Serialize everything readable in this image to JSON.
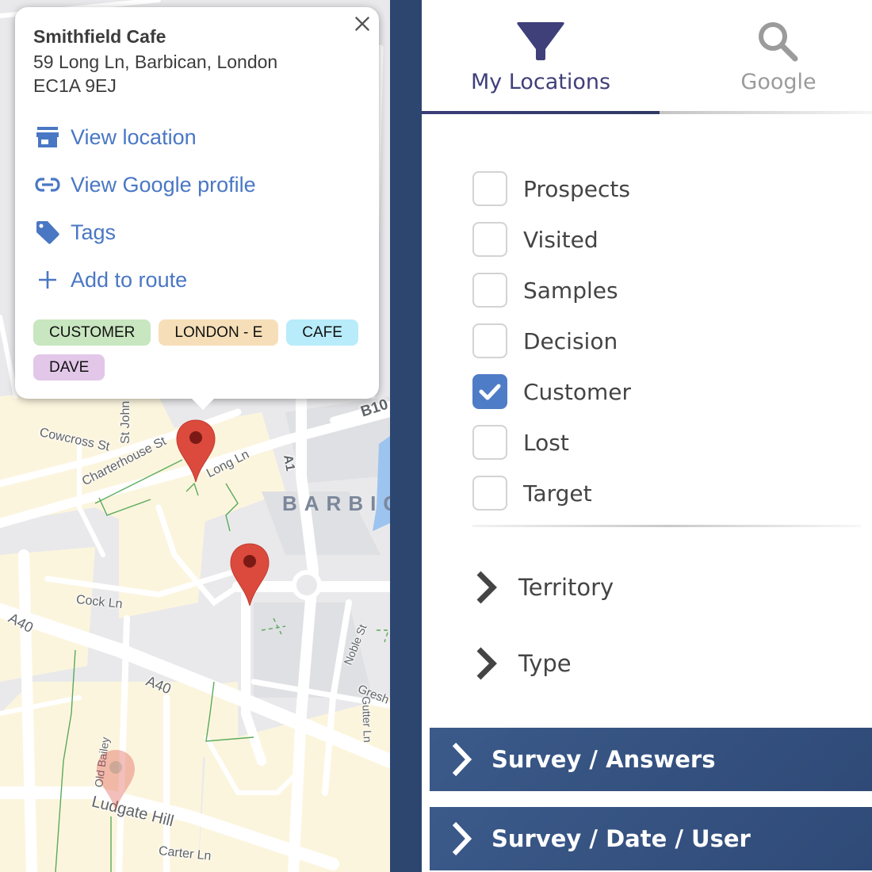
{
  "map": {
    "street_labels": [
      {
        "text": "Cowcross St",
        "name": "street-cowcross"
      },
      {
        "text": "St John",
        "name": "street-st-john"
      },
      {
        "text": "Charterhouse St",
        "name": "street-charterhouse"
      },
      {
        "text": "Long Ln",
        "name": "street-long-ln"
      },
      {
        "text": "A1",
        "name": "road-a1"
      },
      {
        "text": "B10",
        "name": "road-b10"
      },
      {
        "text": "Cock Ln",
        "name": "street-cock-ln"
      },
      {
        "text": "A40",
        "name": "road-a40-west"
      },
      {
        "text": "A40",
        "name": "road-a40"
      },
      {
        "text": "Noble St",
        "name": "street-noble"
      },
      {
        "text": "Gresh",
        "name": "street-gresham"
      },
      {
        "text": "Gutter Ln",
        "name": "street-gutter"
      },
      {
        "text": "Old Bailey",
        "name": "street-old-bailey"
      },
      {
        "text": "Ludgate Hill",
        "name": "street-ludgate-hill"
      },
      {
        "text": "Carter Ln",
        "name": "street-carter"
      }
    ],
    "district_label": "BARBIC",
    "pin_color": "#db4a3d",
    "pin_dot_color": "#7b1a14"
  },
  "popup": {
    "title": "Smithfield Cafe",
    "address_line1": "59 Long Ln, Barbican, London",
    "address_line2": "EC1A 9EJ",
    "close_icon": "close-icon",
    "actions": [
      {
        "label": "View location",
        "icon": "store-icon"
      },
      {
        "label": "View Google profile",
        "icon": "link-icon"
      },
      {
        "label": "Tags",
        "icon": "tag-icon"
      },
      {
        "label": "Add to route",
        "icon": "plus-icon"
      }
    ],
    "tags": [
      {
        "label": "CUSTOMER",
        "color": "#c8e6c0"
      },
      {
        "label": "LONDON - E",
        "color": "#f6dfb8"
      },
      {
        "label": "CAFE",
        "color": "#b8ecfa"
      },
      {
        "label": "DAVE",
        "color": "#e2c7e8"
      }
    ]
  },
  "panel": {
    "tabs": [
      {
        "label": "My Locations",
        "icon": "filter-icon",
        "active": true
      },
      {
        "label": "Google",
        "icon": "search-icon",
        "active": false
      }
    ],
    "filters": [
      {
        "label": "Prospects",
        "checked": false
      },
      {
        "label": "Visited",
        "checked": false
      },
      {
        "label": "Samples",
        "checked": false
      },
      {
        "label": "Decision",
        "checked": false
      },
      {
        "label": "Customer",
        "checked": true
      },
      {
        "label": "Lost",
        "checked": false
      },
      {
        "label": "Target",
        "checked": false
      }
    ],
    "expanders": [
      {
        "label": "Territory"
      },
      {
        "label": "Type"
      }
    ],
    "sections": [
      {
        "label": "Survey / Answers"
      },
      {
        "label": "Survey / Date / User"
      }
    ],
    "accent_color": "#3f3f7a",
    "checkbox_color": "#4f7cc6",
    "section_color": "#34507e"
  }
}
